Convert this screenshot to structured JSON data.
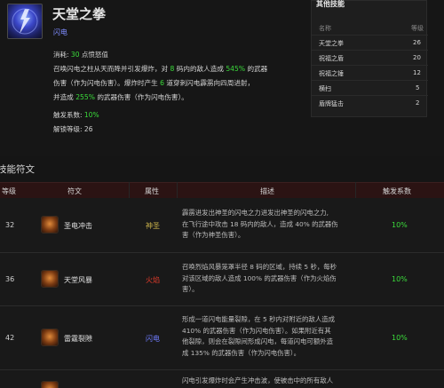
{
  "skill": {
    "name": "天堂之拳",
    "type": "闪电",
    "mana_prefix": "消耗: ",
    "mana_value": "30",
    "mana_suffix": " 点愤怒值",
    "desc_lines": [
      [
        "召唤闪电之柱从天而降并引发爆炸，对 ",
        "8",
        " 码内的敌人造成 ",
        "545%",
        " 的武器"
      ],
      [
        "伤害（作为闪电伤害）。爆炸时产生 ",
        "6",
        " 道穿刺闪电霹雳向四周进射，"
      ],
      [
        "并造成 ",
        "255%",
        " 的武器伤害（作为闪电伤害）。"
      ]
    ],
    "proc_label": "触发系数: ",
    "proc_value": "10%",
    "unlock_label": "解锁等级: ",
    "unlock_value": "26"
  },
  "panel": {
    "title": "其他技能",
    "col_name": "名称",
    "col_level": "等级",
    "rows": [
      {
        "name": "天堂之拳",
        "level": "26"
      },
      {
        "name": "祝福之盾",
        "level": "20"
      },
      {
        "name": "祝福之锤",
        "level": "12"
      },
      {
        "name": "横扫",
        "level": "5"
      },
      {
        "name": "盾牌猛击",
        "level": "2"
      }
    ]
  },
  "runes_title": "技能符文",
  "table": {
    "headers": [
      "等级",
      "符文",
      "属性",
      "描述",
      "触发系数"
    ],
    "rows": [
      {
        "level": "32",
        "rune": "圣电冲击",
        "element": "神圣",
        "element_color": "#c8b14a",
        "desc": [
          "霹雳进发出神圣的闪电之力进发出神圣的闪电之力,",
          "在飞行途中攻击 18 码内的敌人，造成 40% 的武器伤",
          "害（作为神圣伤害）。"
        ],
        "proc": "10%"
      },
      {
        "level": "36",
        "rune": "天堂风暴",
        "element": "火焰",
        "element_color": "#e03b2a",
        "desc": [
          "召唤烈焰风暴笼罩半径 8 码的区域，持续 5 秒，每秒",
          "对该区域的敌人造成 100% 的武器伤害（作为火焰伤",
          "害）。"
        ],
        "proc": "10%"
      },
      {
        "level": "42",
        "rune": "雷霆裂隙",
        "element": "闪电",
        "element_color": "#6f7cff",
        "desc": [
          "形成一道闪电能量裂隙，在 5 秒内对附近的敌人造成",
          "410% 的武器伤害（作为闪电伤害）。如果附近有其",
          "他裂隙，则会在裂隙间形成闪电，每道闪电可额外造",
          "成 135% 的武器伤害（作为闪电伤害）。"
        ],
        "proc": "10%"
      },
      {
        "level": "",
        "rune": "",
        "element": "",
        "element_color": "#cfcfcf",
        "desc": [
          "闪电引发爆炸时会产生冲击波，使被击中的所有敌人"
        ],
        "proc": ""
      }
    ]
  },
  "colors": {
    "accent_green": "#3bdc3b",
    "header_red": "#2b1313",
    "lightning": "#6f7cff"
  }
}
